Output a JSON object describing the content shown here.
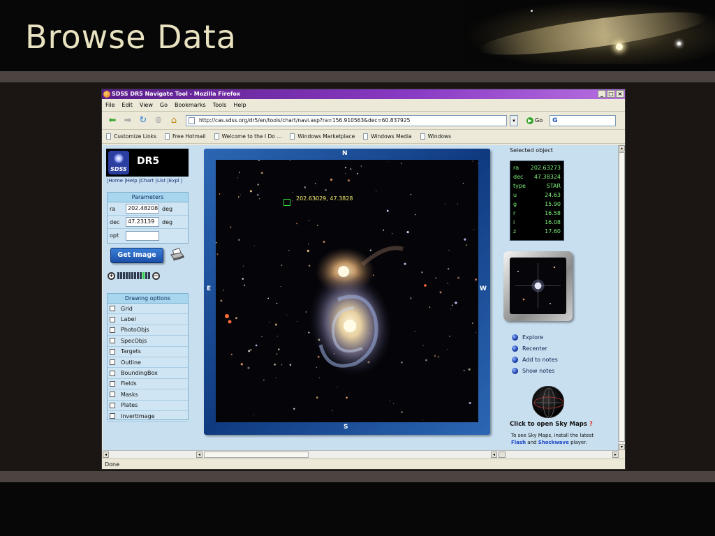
{
  "slide": {
    "title": "Browse Data"
  },
  "browser": {
    "window_title": "SDSS DR5 Navigate Tool - Mozilla Firefox",
    "window_buttons": [
      "_",
      "□",
      "×"
    ],
    "menu": [
      "File",
      "Edit",
      "View",
      "Go",
      "Bookmarks",
      "Tools",
      "Help"
    ],
    "url": "http://cas.sdss.org/dr5/en/tools/chart/navi.asp?ra=156.910563&dec=60.837925",
    "go_label": "Go",
    "search_value": "G",
    "bookmarks": [
      "Customize Links",
      "Free Hotmail",
      "Welcome to the I Do ...",
      "Windows Marketplace",
      "Windows Media",
      "Windows"
    ],
    "status": "Done"
  },
  "sdss": {
    "logo_text": "SDSS",
    "release": "DR5",
    "links": "|Home |Help |Chart |List |Expl |"
  },
  "parameters": {
    "header": "Parameters",
    "ra_label": "ra",
    "ra_value": "202.48208",
    "ra_unit": "deg",
    "dec_label": "dec",
    "dec_value": "47.23139",
    "dec_unit": "deg",
    "opt_label": "opt",
    "opt_value": ""
  },
  "get_image_label": "Get Image",
  "zoom": {
    "ticks": 12,
    "active_index": 9,
    "plus": "+",
    "minus": "−"
  },
  "drawing_options": {
    "header": "Drawing options",
    "items": [
      "Grid",
      "Label",
      "PhotoObjs",
      "SpecObjs",
      "Targets",
      "Outline",
      "BoundingBox",
      "Fields",
      "Masks",
      "Plates",
      "InvertImage"
    ]
  },
  "navigator": {
    "north": "N",
    "south": "S",
    "east": "E",
    "west": "W",
    "selection_label": "202.63029, 47.3828"
  },
  "selected_object": {
    "title": "Selected object",
    "rows": [
      {
        "k": "ra",
        "v": "202.63273"
      },
      {
        "k": "dec",
        "v": "47.38324"
      },
      {
        "k": "type",
        "v": "STAR"
      },
      {
        "k": "u",
        "v": "24.63"
      },
      {
        "k": "g",
        "v": "15.90"
      },
      {
        "k": "r",
        "v": "16.58"
      },
      {
        "k": "i",
        "v": "16.08"
      },
      {
        "k": "z",
        "v": "17.60"
      }
    ]
  },
  "actions": [
    "Explore",
    "Recenter",
    "Add to notes",
    "Show notes"
  ],
  "skymaps": {
    "label": "Click to open Sky Maps",
    "help": "?",
    "note_pre": "To see Sky Maps, install the latest",
    "flash": "Flash",
    "and": "and",
    "shockwave": "Shockwave",
    "note_post": "player."
  }
}
